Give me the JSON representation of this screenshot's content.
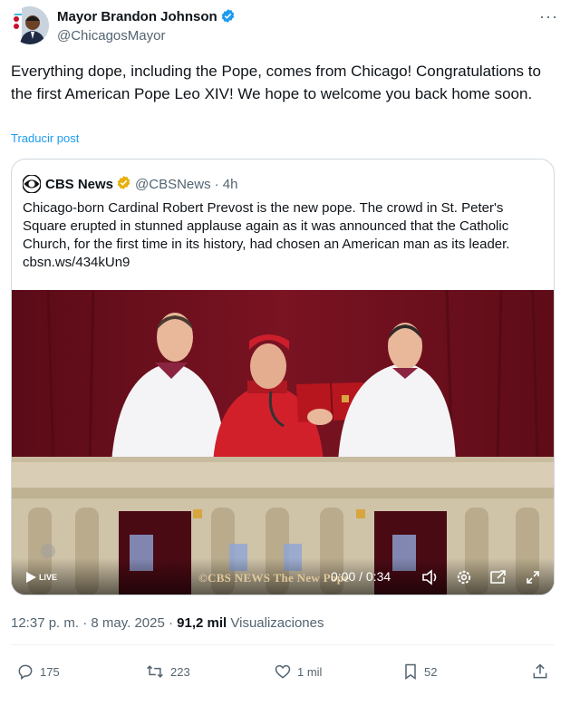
{
  "author": {
    "name": "Mayor Brandon Johnson",
    "handle": "@ChicagosMayor",
    "verified_color": "#1d9bf0"
  },
  "tweet": {
    "text": "Everything dope, including the Pope, comes from Chicago! Congratulations to the first American Pope Leo XIV! We hope to welcome you back home soon.",
    "translate_label": "Traducir post"
  },
  "quote": {
    "source_name": "CBS News",
    "source_handle": "@CBSNews",
    "age": "· 4h",
    "badge_color": "#e8b00c",
    "text": "Chicago-born Cardinal Robert Prevost is the new pope. The crowd in St. Peter's Square erupted in stunned applause again as it was announced that the Catholic Church, for the first time in its history, had chosen an American man as its leader. cbsn.ws/434kUn9",
    "video": {
      "live_label": "LIVE",
      "watermark": "©CBS NEWS The New Pope",
      "time": "0:00 / 0:34",
      "icons": [
        "play-icon",
        "volume-icon",
        "settings-icon",
        "pip-icon",
        "fullscreen-icon"
      ]
    }
  },
  "meta": {
    "time": "12:37 p. m. · 8 may. 2025 ·",
    "views_count": "91,2 mil",
    "views_label": "Visualizaciones"
  },
  "actions": {
    "replies": "175",
    "reposts": "223",
    "likes": "1 mil",
    "bookmarks": "52"
  }
}
